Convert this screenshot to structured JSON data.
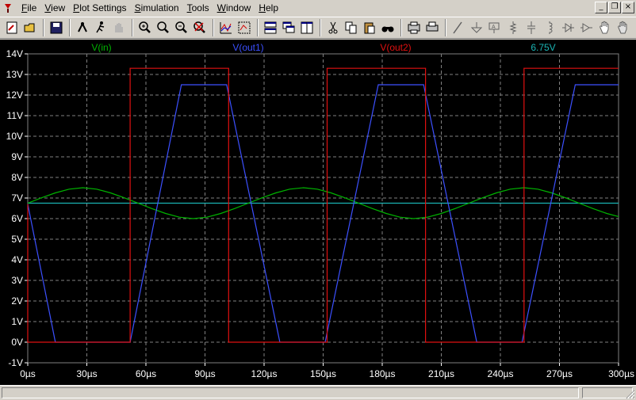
{
  "menu": [
    {
      "first": "F",
      "rest": "ile"
    },
    {
      "first": "V",
      "rest": "iew"
    },
    {
      "first": "P",
      "rest": "lot Settings"
    },
    {
      "first": "S",
      "rest": "imulation"
    },
    {
      "first": "T",
      "rest": "ools"
    },
    {
      "first": "W",
      "rest": "indow"
    },
    {
      "first": "H",
      "rest": "elp"
    }
  ],
  "window_controls": {
    "minimize": "_",
    "restore": "❐",
    "close": "×"
  },
  "toolbar_icons": [
    "new-schematic-icon",
    "open-icon",
    "sep",
    "save-icon",
    "sep",
    "control-panel-icon",
    "run-icon",
    "halt-icon",
    "sep",
    "zoom-in-icon",
    "zoom-pan-icon",
    "zoom-out-icon",
    "zoom-cancel-icon",
    "sep",
    "autorange-icon",
    "zoom-fit-icon",
    "sep",
    "tile-horizontal-icon",
    "cascade-icon",
    "tile-vertical-icon",
    "sep",
    "cut-icon",
    "copy-icon",
    "paste-icon",
    "find-icon",
    "sep",
    "print-setup-icon",
    "print-icon",
    "sep",
    "wire-icon",
    "ground-icon",
    "label-net-icon",
    "resistor-icon",
    "capacitor-icon",
    "inductor-icon",
    "diode-icon",
    "component-icon",
    "move-icon",
    "drag-icon"
  ],
  "colors": {
    "plot_bg": "#000000",
    "grid": "#808080",
    "axis_text": "#ffffff",
    "vin": "#00b400",
    "vout1": "#3c50ff",
    "vout2": "#e01010",
    "cursor": "#1ab4b4"
  },
  "chart_data": {
    "type": "line",
    "x_unit": "µs",
    "y_unit": "V",
    "xlim": [
      0,
      300
    ],
    "ylim": [
      -1,
      14
    ],
    "x_ticks": [
      "0µs",
      "30µs",
      "60µs",
      "90µs",
      "120µs",
      "150µs",
      "180µs",
      "210µs",
      "240µs",
      "270µs",
      "300µs"
    ],
    "y_ticks": [
      "-1V",
      "0V",
      "1V",
      "2V",
      "3V",
      "4V",
      "5V",
      "6V",
      "7V",
      "8V",
      "9V",
      "10V",
      "11V",
      "12V",
      "13V",
      "14V"
    ],
    "legend": {
      "vin": "V(in)",
      "vout1": "V(out1)",
      "vout2": "V(out2)",
      "cursor": "6.75V"
    },
    "grid": true,
    "series": [
      {
        "key": "vin",
        "name": "V(in)",
        "x": [
          0,
          7,
          14,
          21,
          28,
          35,
          42,
          49,
          56,
          63,
          70,
          77,
          84,
          91,
          98,
          105,
          112,
          119,
          126,
          133,
          140,
          147,
          154,
          161,
          168,
          175,
          182,
          189,
          196,
          203,
          210,
          217,
          224,
          231,
          238,
          245,
          252,
          259,
          266,
          273,
          280,
          287,
          294,
          300
        ],
        "y": [
          6.75,
          7.01,
          7.25,
          7.43,
          7.5,
          7.43,
          7.25,
          7.01,
          6.75,
          6.49,
          6.25,
          6.07,
          6.0,
          6.07,
          6.25,
          6.49,
          6.75,
          7.01,
          7.25,
          7.43,
          7.5,
          7.43,
          7.25,
          7.01,
          6.75,
          6.49,
          6.25,
          6.07,
          6.0,
          6.07,
          6.25,
          6.49,
          6.75,
          7.01,
          7.25,
          7.43,
          7.5,
          7.43,
          7.25,
          7.01,
          6.75,
          6.49,
          6.25,
          6.1
        ]
      },
      {
        "key": "vout1",
        "name": "V(out1)",
        "x": [
          0,
          14,
          52,
          78,
          101,
          128,
          151,
          178,
          201,
          228,
          251,
          278,
          300
        ],
        "y": [
          6.7,
          0.0,
          0.0,
          12.5,
          12.5,
          0.0,
          0.0,
          12.5,
          12.5,
          0.0,
          0.0,
          12.5,
          12.5
        ]
      },
      {
        "key": "vout2",
        "name": "V(out2)",
        "x": [
          0,
          0,
          52,
          52,
          102,
          102,
          152,
          152,
          202,
          202,
          252,
          252,
          300
        ],
        "y": [
          6.7,
          0.0,
          0.0,
          13.3,
          13.3,
          0.0,
          0.0,
          13.3,
          13.3,
          0.0,
          0.0,
          13.3,
          13.3
        ]
      }
    ],
    "cursor_level": 6.75
  },
  "status": {
    "main": "",
    "right": ""
  }
}
